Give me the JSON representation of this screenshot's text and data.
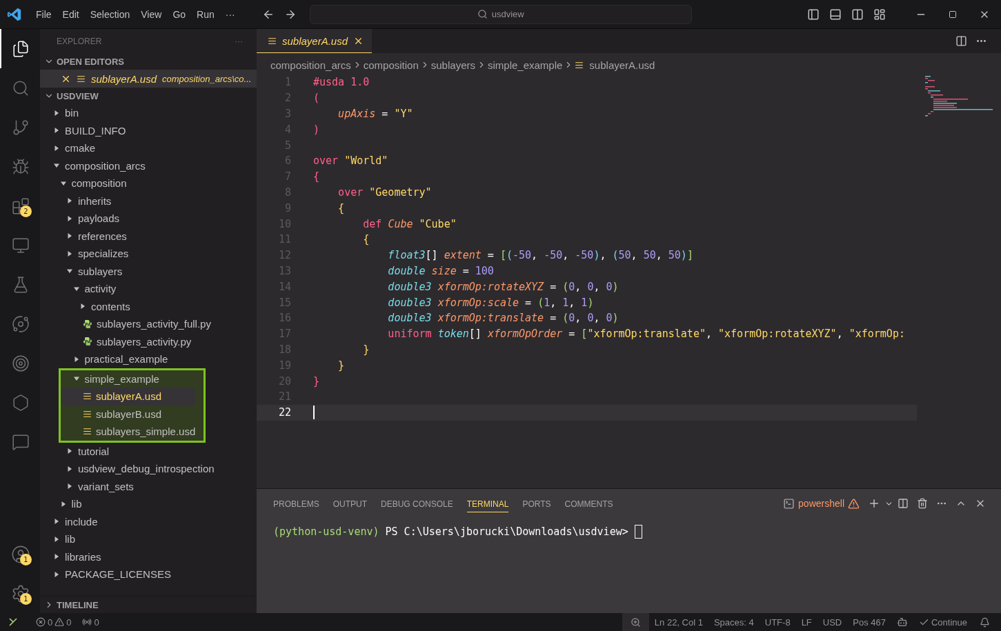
{
  "menu": [
    "File",
    "Edit",
    "Selection",
    "View",
    "Go",
    "Run",
    "···"
  ],
  "command_center": {
    "value": "usdview"
  },
  "activity_bar": [
    {
      "kind": "files",
      "selected": true
    },
    {
      "kind": "search",
      "selected": false
    },
    {
      "kind": "git",
      "selected": false
    },
    {
      "kind": "debug",
      "selected": false
    },
    {
      "kind": "extensions",
      "selected": false,
      "badge": "2"
    },
    {
      "kind": "remote",
      "selected": false
    },
    {
      "kind": "testing",
      "selected": false
    },
    {
      "kind": "orbit",
      "selected": false
    },
    {
      "kind": "target",
      "selected": false
    },
    {
      "kind": "hexagon",
      "selected": false
    },
    {
      "kind": "chat",
      "selected": false
    }
  ],
  "activity_bottom": [
    {
      "kind": "account",
      "badge": "1"
    },
    {
      "kind": "settings",
      "badge": "1"
    }
  ],
  "sidebar": {
    "title": "EXPLORER",
    "more": "···",
    "open_editors": {
      "title": "OPEN EDITORS",
      "expanded": true,
      "items": [
        {
          "name": "sublayerA.usd",
          "path": "composition_arcs\\co...",
          "selected": true
        }
      ]
    },
    "folder": {
      "title": "USDVIEW",
      "expanded": true,
      "items": [
        {
          "name": "bin",
          "kind": "folder",
          "expanded": false
        },
        {
          "name": "BUILD_INFO",
          "kind": "folder",
          "expanded": false
        },
        {
          "name": "cmake",
          "kind": "folder",
          "expanded": false
        },
        {
          "name": "composition_arcs",
          "kind": "folder",
          "expanded": true,
          "children": [
            {
              "name": "composition",
              "kind": "folder",
              "expanded": true,
              "children": [
                {
                  "name": "inherits",
                  "kind": "folder",
                  "expanded": false
                },
                {
                  "name": "payloads",
                  "kind": "folder",
                  "expanded": false
                },
                {
                  "name": "references",
                  "kind": "folder",
                  "expanded": false
                },
                {
                  "name": "specializes",
                  "kind": "folder",
                  "expanded": false
                },
                {
                  "name": "sublayers",
                  "kind": "folder",
                  "expanded": true,
                  "children": [
                    {
                      "name": "activity",
                      "kind": "folder",
                      "expanded": true,
                      "children": [
                        {
                          "name": "contents",
                          "kind": "folder",
                          "expanded": false
                        },
                        {
                          "name": "sublayers_activity_full.py",
                          "kind": "python",
                          "selected": false
                        },
                        {
                          "name": "sublayers_activity.py",
                          "kind": "python",
                          "selected": false
                        }
                      ]
                    },
                    {
                      "name": "practical_example",
                      "kind": "folder",
                      "expanded": false
                    },
                    {
                      "name": "simple_example",
                      "kind": "folder",
                      "expanded": true,
                      "highlighted": true,
                      "children": [
                        {
                          "name": "sublayerA.usd",
                          "kind": "usd",
                          "selected": true
                        },
                        {
                          "name": "sublayerB.usd",
                          "kind": "usd",
                          "selected": false
                        },
                        {
                          "name": "sublayers_simple.usd",
                          "kind": "usd",
                          "selected": false
                        }
                      ]
                    }
                  ]
                },
                {
                  "name": "tutorial",
                  "kind": "folder",
                  "expanded": false
                },
                {
                  "name": "usdview_debug_introspection",
                  "kind": "folder",
                  "expanded": false
                },
                {
                  "name": "variant_sets",
                  "kind": "folder",
                  "expanded": false
                }
              ]
            },
            {
              "name": "lib",
              "kind": "folder",
              "expanded": false
            }
          ]
        },
        {
          "name": "include",
          "kind": "folder",
          "expanded": false
        },
        {
          "name": "lib",
          "kind": "folder",
          "expanded": false
        },
        {
          "name": "libraries",
          "kind": "folder",
          "expanded": false
        },
        {
          "name": "PACKAGE_LICENSES",
          "kind": "folder",
          "expanded": false
        }
      ]
    },
    "timeline": {
      "title": "TIMELINE",
      "expanded": false
    }
  },
  "editor": {
    "tabs": [
      {
        "label": "sublayerA.usd",
        "selected": true
      }
    ],
    "breadcrumbs": [
      "composition_arcs",
      "composition",
      "sublayers",
      "simple_example",
      "sublayerA.usd"
    ],
    "lines": [
      {
        "n": "1",
        "current": false,
        "tokens": [
          {
            "t": "#usda 1.0",
            "kind": "keyword"
          }
        ]
      },
      {
        "n": "2",
        "current": false,
        "tokens": [
          {
            "t": "(",
            "kind": "bracket1"
          }
        ]
      },
      {
        "n": "3",
        "current": false,
        "tokens": [
          {
            "t": "    upAxis",
            "kind": "attr"
          },
          {
            "t": " = ",
            "kind": "plain"
          },
          {
            "t": "\"Y\"",
            "kind": "string"
          }
        ]
      },
      {
        "n": "4",
        "current": false,
        "tokens": [
          {
            "t": ")",
            "kind": "bracket1"
          }
        ]
      },
      {
        "n": "5",
        "current": false
      },
      {
        "n": "6",
        "current": false,
        "tokens": [
          {
            "t": "over ",
            "kind": "keyword"
          },
          {
            "t": "\"World\"",
            "kind": "string"
          }
        ]
      },
      {
        "n": "7",
        "current": false,
        "tokens": [
          {
            "t": "{",
            "kind": "bracket1"
          }
        ]
      },
      {
        "n": "8",
        "current": false,
        "tokens": [
          {
            "t": "    over ",
            "kind": "keyword"
          },
          {
            "t": "\"Geometry\"",
            "kind": "string"
          }
        ]
      },
      {
        "n": "9",
        "current": false,
        "tokens": [
          {
            "t": "    {",
            "kind": "bracket2"
          }
        ]
      },
      {
        "n": "10",
        "current": false,
        "tokens": [
          {
            "t": "        def ",
            "kind": "keyword"
          },
          {
            "t": "Cube ",
            "kind": "attr"
          },
          {
            "t": "\"Cube\"",
            "kind": "string"
          }
        ]
      },
      {
        "n": "11",
        "current": false,
        "tokens": [
          {
            "t": "        {",
            "kind": "bracket2"
          }
        ]
      },
      {
        "n": "12",
        "current": false,
        "tokens": [
          {
            "t": "            float3",
            "kind": "type"
          },
          {
            "t": "[] ",
            "kind": "plain"
          },
          {
            "t": "extent",
            "kind": "attr"
          },
          {
            "t": " = ",
            "kind": "plain"
          },
          {
            "t": "[",
            "kind": "bracket3"
          },
          {
            "t": "(",
            "kind": "bracket4"
          },
          {
            "t": "-50",
            "kind": "number"
          },
          {
            "t": ", ",
            "kind": "plain"
          },
          {
            "t": "-50",
            "kind": "number"
          },
          {
            "t": ", ",
            "kind": "plain"
          },
          {
            "t": "-50",
            "kind": "number"
          },
          {
            "t": ")",
            "kind": "bracket4"
          },
          {
            "t": ", ",
            "kind": "plain"
          },
          {
            "t": "(",
            "kind": "bracket4"
          },
          {
            "t": "50",
            "kind": "number"
          },
          {
            "t": ", ",
            "kind": "plain"
          },
          {
            "t": "50",
            "kind": "number"
          },
          {
            "t": ", ",
            "kind": "plain"
          },
          {
            "t": "50",
            "kind": "number"
          },
          {
            "t": ")",
            "kind": "bracket4"
          },
          {
            "t": "]",
            "kind": "bracket3"
          }
        ]
      },
      {
        "n": "13",
        "current": false,
        "tokens": [
          {
            "t": "            double ",
            "kind": "type"
          },
          {
            "t": "size",
            "kind": "attr"
          },
          {
            "t": " = ",
            "kind": "plain"
          },
          {
            "t": "100",
            "kind": "number"
          }
        ]
      },
      {
        "n": "14",
        "current": false,
        "tokens": [
          {
            "t": "            double3 ",
            "kind": "type"
          },
          {
            "t": "xformOp:rotateXYZ",
            "kind": "attr"
          },
          {
            "t": " = ",
            "kind": "plain"
          },
          {
            "t": "(",
            "kind": "bracket3"
          },
          {
            "t": "0",
            "kind": "number"
          },
          {
            "t": ", ",
            "kind": "plain"
          },
          {
            "t": "0",
            "kind": "number"
          },
          {
            "t": ", ",
            "kind": "plain"
          },
          {
            "t": "0",
            "kind": "number"
          },
          {
            "t": ")",
            "kind": "bracket3"
          }
        ]
      },
      {
        "n": "15",
        "current": false,
        "tokens": [
          {
            "t": "            double3 ",
            "kind": "type"
          },
          {
            "t": "xformOp:scale",
            "kind": "attr"
          },
          {
            "t": " = ",
            "kind": "plain"
          },
          {
            "t": "(",
            "kind": "bracket3"
          },
          {
            "t": "1",
            "kind": "number"
          },
          {
            "t": ", ",
            "kind": "plain"
          },
          {
            "t": "1",
            "kind": "number"
          },
          {
            "t": ", ",
            "kind": "plain"
          },
          {
            "t": "1",
            "kind": "number"
          },
          {
            "t": ")",
            "kind": "bracket3"
          }
        ]
      },
      {
        "n": "16",
        "current": false,
        "tokens": [
          {
            "t": "            double3 ",
            "kind": "type"
          },
          {
            "t": "xformOp:translate",
            "kind": "attr"
          },
          {
            "t": " = ",
            "kind": "plain"
          },
          {
            "t": "(",
            "kind": "bracket3"
          },
          {
            "t": "0",
            "kind": "number"
          },
          {
            "t": ", ",
            "kind": "plain"
          },
          {
            "t": "0",
            "kind": "number"
          },
          {
            "t": ", ",
            "kind": "plain"
          },
          {
            "t": "0",
            "kind": "number"
          },
          {
            "t": ")",
            "kind": "bracket3"
          }
        ]
      },
      {
        "n": "17",
        "current": false,
        "tokens": [
          {
            "t": "            uniform ",
            "kind": "keyword"
          },
          {
            "t": "token",
            "kind": "type"
          },
          {
            "t": "[] ",
            "kind": "plain"
          },
          {
            "t": "xformOpOrder",
            "kind": "attr"
          },
          {
            "t": " = ",
            "kind": "plain"
          },
          {
            "t": "[",
            "kind": "bracket3"
          },
          {
            "t": "\"xformOp:translate\"",
            "kind": "string"
          },
          {
            "t": ", ",
            "kind": "plain"
          },
          {
            "t": "\"xformOp:rotateXYZ\"",
            "kind": "string"
          },
          {
            "t": ", ",
            "kind": "plain"
          },
          {
            "t": "\"xformOp:",
            "kind": "string"
          }
        ]
      },
      {
        "n": "18",
        "current": false,
        "tokens": [
          {
            "t": "        }",
            "kind": "bracket2"
          }
        ]
      },
      {
        "n": "19",
        "current": false,
        "tokens": [
          {
            "t": "    }",
            "kind": "bracket2"
          }
        ]
      },
      {
        "n": "20",
        "current": false,
        "tokens": [
          {
            "t": "}",
            "kind": "bracket1"
          }
        ]
      },
      {
        "n": "21",
        "current": false
      },
      {
        "n": "22",
        "current": true
      }
    ]
  },
  "panel": {
    "tabs": [
      {
        "label": "PROBLEMS",
        "selected": false
      },
      {
        "label": "OUTPUT",
        "selected": false
      },
      {
        "label": "DEBUG CONSOLE",
        "selected": false
      },
      {
        "label": "TERMINAL",
        "selected": true
      },
      {
        "label": "PORTS",
        "selected": false
      },
      {
        "label": "COMMENTS",
        "selected": false
      }
    ],
    "shell": "powershell",
    "terminal": {
      "env": "(python-usd-venv)",
      "prompt": "PS C:\\Users\\jborucki\\Downloads\\usdview>"
    }
  },
  "status_bar": {
    "errors": "0",
    "warnings": "0",
    "ports": "0",
    "right": [
      "Ln 22, Col 1",
      "Spaces: 4",
      "UTF-8",
      "LF",
      "USD",
      "Pos 467"
    ],
    "continue": "Continue"
  }
}
